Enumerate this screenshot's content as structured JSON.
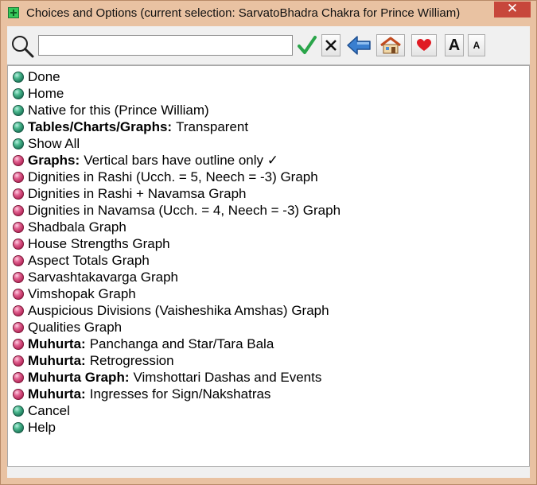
{
  "window": {
    "title": "Choices and Options (current selection: SarvatoBhadra Chakra for Prince William)",
    "close_label": "✕",
    "icons": {
      "app": "app-icon",
      "close": "close-icon"
    }
  },
  "toolbar": {
    "search": {
      "value": "",
      "placeholder": "",
      "icon": "search-icon"
    },
    "buttons": [
      {
        "name": "ok-button",
        "icon": "checkmark-icon"
      },
      {
        "name": "clear-button",
        "icon": "close-icon"
      },
      {
        "name": "back-button",
        "icon": "back-arrow-icon"
      },
      {
        "name": "home-button",
        "icon": "home-icon"
      },
      {
        "name": "favorites-button",
        "icon": "heart-icon"
      },
      {
        "name": "font-larger-button",
        "label": "A",
        "icon": "font-larger-icon"
      },
      {
        "name": "font-smaller-button",
        "label": "A",
        "icon": "font-smaller-icon"
      }
    ]
  },
  "colors": {
    "title_bar": "#e9c2a2",
    "close_button": "#c7473b",
    "bullet_green": "#2f9a75",
    "bullet_red": "#c0376a",
    "checkmark_green": "#2aa54a",
    "heart_red": "#e01b24",
    "arrow_blue": "#3a7fd0"
  },
  "items": [
    {
      "bold": "",
      "text": "Done",
      "bullet": "green"
    },
    {
      "bold": "",
      "text": "Home",
      "bullet": "green"
    },
    {
      "bold": "",
      "text": "Native for this (Prince William)",
      "bullet": "green"
    },
    {
      "bold": "Tables/Charts/Graphs:",
      "text": "Transparent",
      "bullet": "green"
    },
    {
      "bold": "",
      "text": "Show All",
      "bullet": "green"
    },
    {
      "bold": "Graphs:",
      "text": "Vertical bars have outline only ✓",
      "bullet": "red"
    },
    {
      "bold": "",
      "text": "Dignities in Rashi (Ucch. = 5, Neech = -3) Graph",
      "bullet": "red"
    },
    {
      "bold": "",
      "text": "Dignities in Rashi + Navamsa Graph",
      "bullet": "red"
    },
    {
      "bold": "",
      "text": "Dignities in Navamsa (Ucch. = 4, Neech = -3) Graph",
      "bullet": "red"
    },
    {
      "bold": "",
      "text": "Shadbala Graph",
      "bullet": "red"
    },
    {
      "bold": "",
      "text": "House Strengths Graph",
      "bullet": "red"
    },
    {
      "bold": "",
      "text": "Aspect Totals Graph",
      "bullet": "red"
    },
    {
      "bold": "",
      "text": "Sarvashtakavarga Graph",
      "bullet": "red"
    },
    {
      "bold": "",
      "text": "Vimshopak Graph",
      "bullet": "red"
    },
    {
      "bold": "",
      "text": "Auspicious Divisions (Vaisheshika Amshas) Graph",
      "bullet": "red"
    },
    {
      "bold": "",
      "text": "Qualities Graph",
      "bullet": "red"
    },
    {
      "bold": "Muhurta:",
      "text": "Panchanga and Star/Tara Bala",
      "bullet": "red"
    },
    {
      "bold": "Muhurta:",
      "text": "Retrogression",
      "bullet": "red"
    },
    {
      "bold": "Muhurta Graph:",
      "text": "Vimshottari Dashas and Events",
      "bullet": "red"
    },
    {
      "bold": "Muhurta:",
      "text": "Ingresses for Sign/Nakshatras",
      "bullet": "red"
    },
    {
      "bold": "",
      "text": "Cancel",
      "bullet": "green"
    },
    {
      "bold": "",
      "text": "Help",
      "bullet": "green"
    }
  ]
}
